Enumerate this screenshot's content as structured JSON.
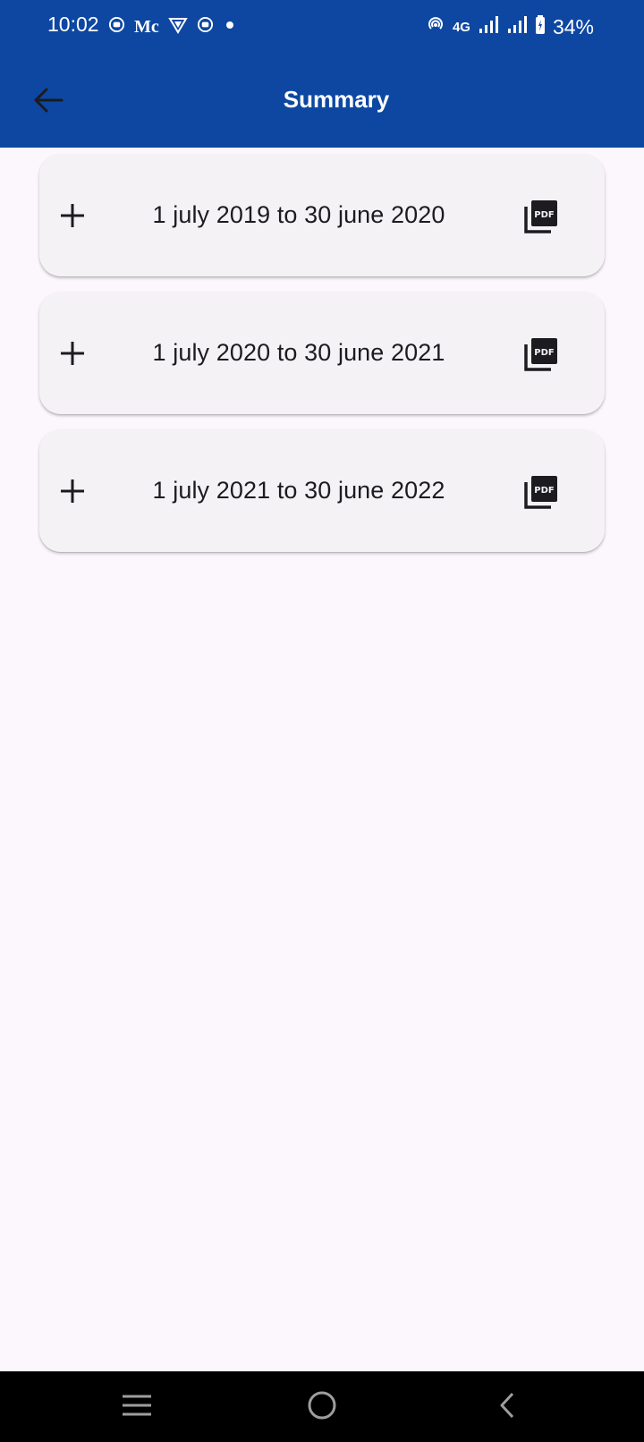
{
  "status_bar": {
    "time": "10:02",
    "carrier_badge": "Mc",
    "network": "4G",
    "battery": "34%",
    "icons": [
      "record-icon",
      "carrier-badge",
      "vpn-icon",
      "record-icon",
      "dot-icon",
      "hotspot-icon",
      "signal-icon",
      "signal-icon",
      "battery-icon"
    ]
  },
  "appbar": {
    "title": "Summary",
    "color": "#0d47a1",
    "back_icon": "arrow-left-icon"
  },
  "periods": [
    {
      "label": "1 july 2019 to 30 june 2020",
      "expand_icon": "plus-icon",
      "pdf_icon": "pdf-icon"
    },
    {
      "label": "1 july 2020 to 30 june 2021",
      "expand_icon": "plus-icon",
      "pdf_icon": "pdf-icon"
    },
    {
      "label": "1 july 2021 to 30 june 2022",
      "expand_icon": "plus-icon",
      "pdf_icon": "pdf-icon"
    }
  ],
  "nav_bar": {
    "buttons": [
      "recents-icon",
      "home-icon",
      "back-icon"
    ]
  }
}
